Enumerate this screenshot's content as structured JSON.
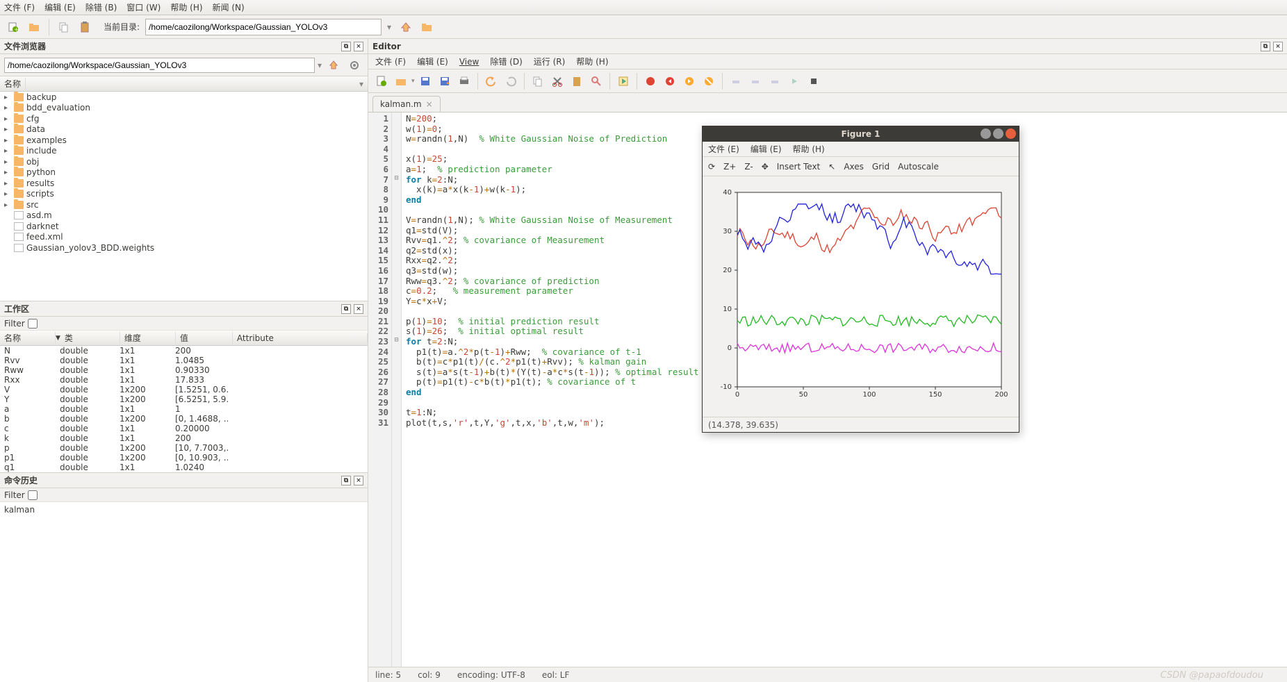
{
  "top_menu": [
    "文件 (F)",
    "编辑 (E)",
    "除错 (B)",
    "窗口 (W)",
    "帮助 (H)",
    "新闻 (N)"
  ],
  "toolbar": {
    "currentdir_label": "当前目录:",
    "currentdir_value": "/home/caozilong/Workspace/Gaussian_YOLOv3"
  },
  "filebrowser": {
    "title": "文件浏览器",
    "path": "/home/caozilong/Workspace/Gaussian_YOLOv3",
    "name_column": "名称",
    "items": [
      {
        "t": "folder",
        "n": "backup"
      },
      {
        "t": "folder",
        "n": "bdd_evaluation"
      },
      {
        "t": "folder",
        "n": "cfg"
      },
      {
        "t": "folder",
        "n": "data"
      },
      {
        "t": "folder",
        "n": "examples"
      },
      {
        "t": "folder",
        "n": "include"
      },
      {
        "t": "folder",
        "n": "obj"
      },
      {
        "t": "folder",
        "n": "python"
      },
      {
        "t": "folder",
        "n": "results"
      },
      {
        "t": "folder",
        "n": "scripts"
      },
      {
        "t": "folder",
        "n": "src"
      },
      {
        "t": "file",
        "n": "asd.m"
      },
      {
        "t": "file",
        "n": "darknet"
      },
      {
        "t": "file",
        "n": "feed.xml"
      },
      {
        "t": "file",
        "n": "Gaussian_yolov3_BDD.weights"
      }
    ]
  },
  "workspace": {
    "title": "工作区",
    "filter_label": "Filter",
    "columns": [
      "名称",
      "类",
      "维度",
      "值",
      "Attribute"
    ],
    "rows": [
      [
        "N",
        "double",
        "1x1",
        "200",
        ""
      ],
      [
        "Rvv",
        "double",
        "1x1",
        "1.0485",
        ""
      ],
      [
        "Rww",
        "double",
        "1x1",
        "0.90330",
        ""
      ],
      [
        "Rxx",
        "double",
        "1x1",
        "17.833",
        ""
      ],
      [
        "V",
        "double",
        "1x200",
        "[1.5251, 0.6…",
        ""
      ],
      [
        "Y",
        "double",
        "1x200",
        "[6.5251, 5.9…",
        ""
      ],
      [
        "a",
        "double",
        "1x1",
        "1",
        ""
      ],
      [
        "b",
        "double",
        "1x200",
        "[0, 1.4688, …",
        ""
      ],
      [
        "c",
        "double",
        "1x1",
        "0.20000",
        ""
      ],
      [
        "k",
        "double",
        "1x1",
        "200",
        ""
      ],
      [
        "p",
        "double",
        "1x200",
        "[10, 7.7003,…",
        ""
      ],
      [
        "p1",
        "double",
        "1x200",
        "[0, 10.903, …",
        ""
      ],
      [
        "q1",
        "double",
        "1x1",
        "1.0240",
        ""
      ]
    ]
  },
  "history": {
    "title": "命令历史",
    "filter_label": "Filter",
    "items": [
      "kalman"
    ]
  },
  "editor": {
    "title": "Editor",
    "menu": [
      "文件 (F)",
      "编辑 (E)",
      "View",
      "除错 (D)",
      "运行 (R)",
      "帮助 (H)"
    ],
    "tab": "kalman.m",
    "status": {
      "line": "line: 5",
      "col": "col: 9",
      "enc": "encoding: UTF-8",
      "eol": "eol: LF"
    }
  },
  "figure": {
    "title": "Figure 1",
    "menu": [
      "文件 (E)",
      "编辑 (E)",
      "帮助 (H)"
    ],
    "tools": [
      "Z+",
      "Z-",
      "Insert Text",
      "Axes",
      "Grid",
      "Autoscale"
    ],
    "coords": "(14.378, 39.635)"
  },
  "chart_data": {
    "type": "line",
    "xlim": [
      0,
      200
    ],
    "ylim": [
      -10,
      40
    ],
    "xticks": [
      0,
      50,
      100,
      150,
      200
    ],
    "yticks": [
      -10,
      0,
      10,
      20,
      30,
      40
    ],
    "description": "Kalman filter simulation: upper red/blue pair ~25–35, green noise ~7, magenta noise ~0",
    "series_names": [
      "s (red)",
      "Y (green)",
      "x (blue)",
      "w (magenta)"
    ]
  },
  "watermark": "CSDN @papaofdoudou"
}
